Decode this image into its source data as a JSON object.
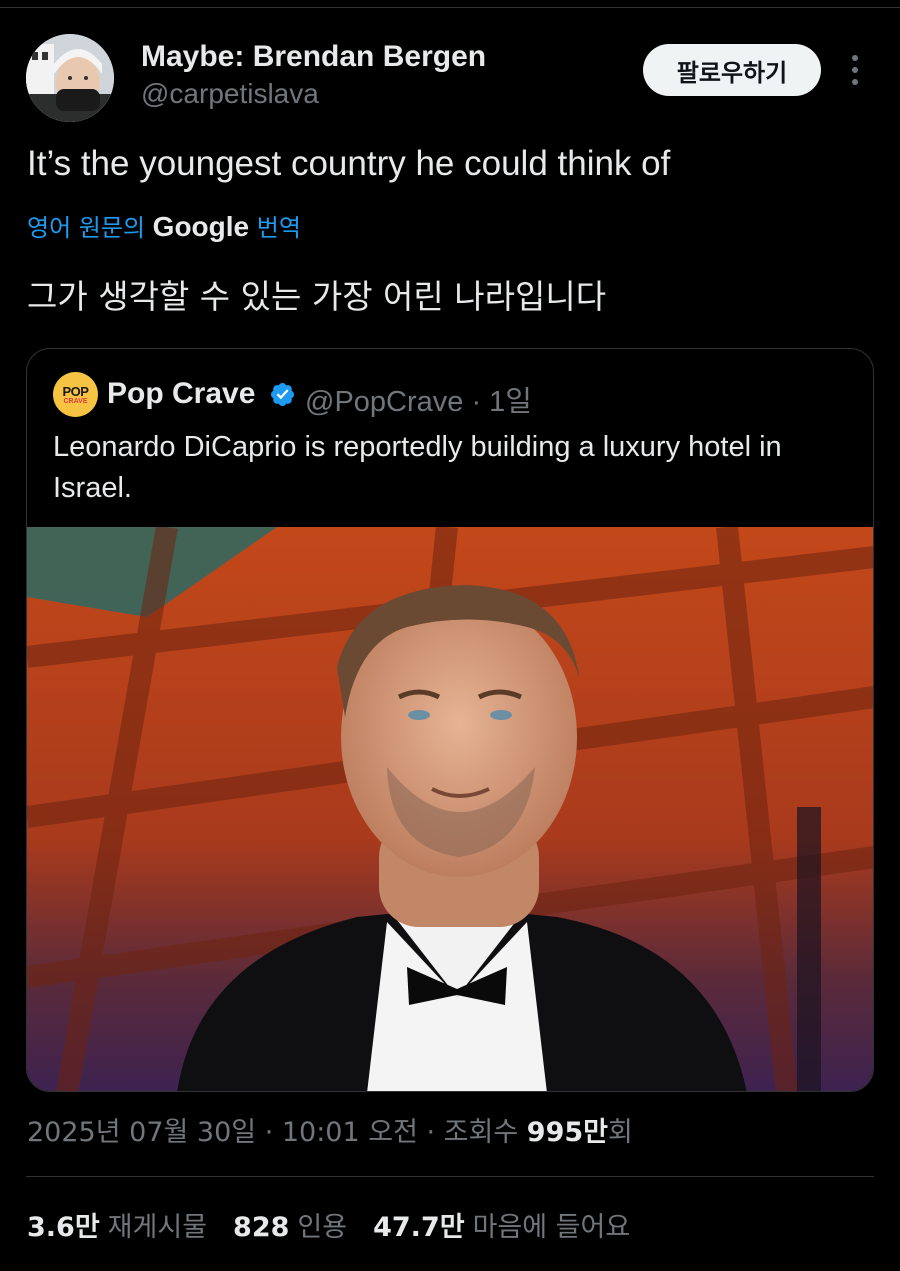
{
  "author": {
    "name": "Maybe: Brendan Bergen",
    "handle": "@carpetislava"
  },
  "follow_label": "팔로우하기",
  "tweet": {
    "text": "It’s the youngest country he could think of",
    "translate_prefix": "영어 원문의",
    "translate_brand": "Google",
    "translate_suffix": "번역",
    "translated_text": "그가 생각할 수 있는 가장 어린 나라입니다"
  },
  "quote": {
    "logo_top": "POP",
    "logo_bottom": "CRAVE",
    "name": "Pop Crave",
    "handle_time": "@PopCrave · 1일",
    "text": "Leonardo DiCaprio is reportedly building a luxury hotel in Israel."
  },
  "meta": {
    "timestamp": "2025년 07월 30일 · 10:01 오전 · 조회수 ",
    "views": "995만",
    "views_suffix": "회"
  },
  "stats": {
    "reposts_num": "3.6만",
    "reposts_label": "재게시물",
    "quotes_num": "828",
    "quotes_label": "인용",
    "likes_num": "47.7만",
    "likes_label": "마음에 들어요"
  },
  "colors": {
    "background": "#000000",
    "link": "#1d9bf0",
    "muted": "#71767b",
    "text": "#e7e9ea",
    "verified": "#1d9bf0"
  },
  "icons": [
    "more-icon",
    "verified-badge-icon"
  ]
}
